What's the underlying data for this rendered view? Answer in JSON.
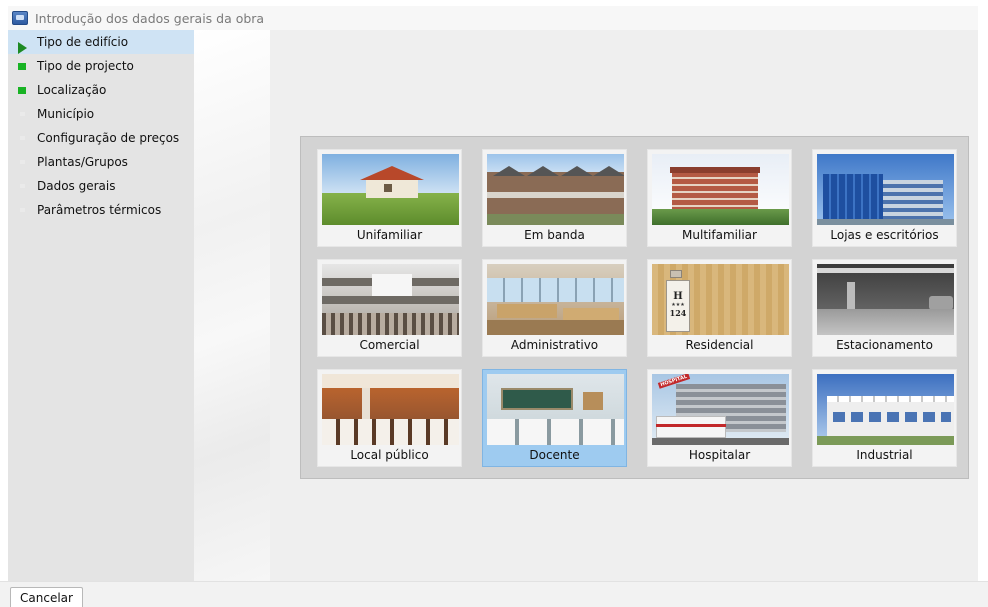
{
  "window": {
    "title": "Introdução dos dados gerais da obra",
    "icon": "app-icon"
  },
  "sidebar": {
    "items": [
      {
        "label": "Tipo de edifício",
        "icon": "play-arrow-icon",
        "state": "current"
      },
      {
        "label": "Tipo de projecto",
        "icon": "green-square-icon",
        "state": "done"
      },
      {
        "label": "Localização",
        "icon": "green-square-icon",
        "state": "done"
      },
      {
        "label": "Município",
        "icon": "grey-square-icon",
        "state": "pending"
      },
      {
        "label": "Configuração de preços",
        "icon": "grey-square-icon",
        "state": "pending"
      },
      {
        "label": "Plantas/Grupos",
        "icon": "grey-square-icon",
        "state": "pending"
      },
      {
        "label": "Dados gerais",
        "icon": "grey-square-icon",
        "state": "pending"
      },
      {
        "label": "Parâmetros térmicos",
        "icon": "grey-square-icon",
        "state": "pending"
      }
    ]
  },
  "building_types": {
    "selected": "Docente",
    "items": [
      {
        "label": "Unifamiliar",
        "picture": "single-family-house"
      },
      {
        "label": "Em banda",
        "picture": "row-houses"
      },
      {
        "label": "Multifamiliar",
        "picture": "apartment-block"
      },
      {
        "label": "Lojas e escritórios",
        "picture": "office-glass-building"
      },
      {
        "label": "Comercial",
        "picture": "shopping-mall-interior"
      },
      {
        "label": "Administrativo",
        "picture": "office-interior"
      },
      {
        "label": "Residencial",
        "picture": "hotel-door-sign"
      },
      {
        "label": "Estacionamento",
        "picture": "parking-garage"
      },
      {
        "label": "Local público",
        "picture": "restaurant-interior"
      },
      {
        "label": "Docente",
        "picture": "classroom"
      },
      {
        "label": "Hospitalar",
        "picture": "hospital-with-ambulance"
      },
      {
        "label": "Industrial",
        "picture": "industrial-building"
      }
    ]
  },
  "sign": {
    "letter": "H",
    "stars": "★★★",
    "number": "124"
  },
  "hospital_sign": "HOSPITAL",
  "footer": {
    "cancel_label": "Cancelar"
  },
  "colors": {
    "selected": "#9ecbf0",
    "active_nav": "#cfe3f4",
    "done_green": "#18b324",
    "current_green": "#1d8a23"
  }
}
